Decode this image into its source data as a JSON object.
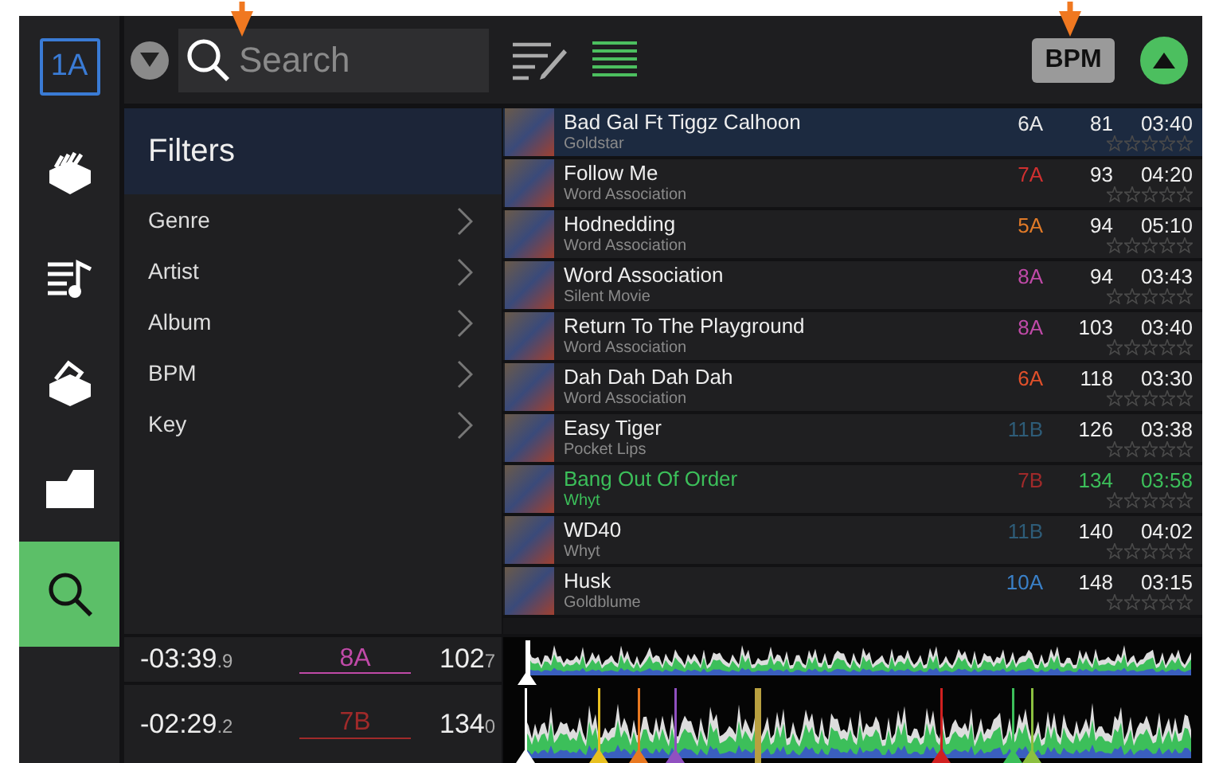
{
  "deck_badge": "1A",
  "sidebar": {
    "items": [
      {
        "kind": "crates",
        "selected": false
      },
      {
        "kind": "playlist",
        "selected": false
      },
      {
        "kind": "prepare",
        "selected": false
      },
      {
        "kind": "folder",
        "selected": false
      },
      {
        "kind": "search",
        "selected": true
      }
    ]
  },
  "toolbar": {
    "search": {
      "placeholder": "Search"
    },
    "view_buttons": [
      {
        "kind": "edit",
        "selected": false
      },
      {
        "kind": "list",
        "selected": true
      }
    ],
    "sort_button": "BPM"
  },
  "filters": {
    "title": "Filters",
    "items": [
      "Genre",
      "Artist",
      "Album",
      "BPM",
      "Key"
    ]
  },
  "tracks": [
    {
      "title": "Bad Gal Ft Tiggz Calhoon",
      "artist": "Goldstar",
      "key": "6A",
      "color": "#e8e8e8",
      "bpm": "81",
      "time": "03:40",
      "stars": 0,
      "selected": true,
      "loaded": false
    },
    {
      "title": "Follow Me",
      "artist": "Word Association",
      "key": "7A",
      "color": "#d03030",
      "bpm": "93",
      "time": "04:20",
      "stars": 0,
      "selected": false,
      "loaded": false
    },
    {
      "title": "Hodnedding",
      "artist": "Word Association",
      "key": "5A",
      "color": "#e07a28",
      "bpm": "94",
      "time": "05:10",
      "stars": 0,
      "selected": false,
      "loaded": false
    },
    {
      "title": "Word Association",
      "artist": "Silent Movie",
      "key": "8A",
      "color": "#c04aa8",
      "bpm": "94",
      "time": "03:43",
      "stars": 0,
      "selected": false,
      "loaded": false
    },
    {
      "title": "Return To The Playground",
      "artist": "Word Association",
      "key": "8A",
      "color": "#c04aa8",
      "bpm": "103",
      "time": "03:40",
      "stars": 0,
      "selected": false,
      "loaded": false
    },
    {
      "title": "Dah Dah Dah Dah",
      "artist": "Word Association",
      "key": "6A",
      "color": "#e0502a",
      "bpm": "118",
      "time": "03:30",
      "stars": 0,
      "selected": false,
      "loaded": false
    },
    {
      "title": "Easy Tiger",
      "artist": "Pocket Lips",
      "key": "11B",
      "color": "#2e5c78",
      "bpm": "126",
      "time": "03:38",
      "stars": 0,
      "selected": false,
      "loaded": false
    },
    {
      "title": "Bang Out Of Order",
      "artist": "Whyt",
      "key": "7B",
      "color": "#a02a2a",
      "bpm": "134",
      "time": "03:58",
      "stars": 0,
      "selected": false,
      "loaded": true
    },
    {
      "title": "WD40",
      "artist": "Whyt",
      "key": "11B",
      "color": "#2e5c78",
      "bpm": "140",
      "time": "04:02",
      "stars": 0,
      "selected": false,
      "loaded": false
    },
    {
      "title": "Husk",
      "artist": "Goldblume",
      "key": "10A",
      "color": "#3a80c8",
      "bpm": "148",
      "time": "03:15",
      "stars": 0,
      "selected": false,
      "loaded": false
    }
  ],
  "decks": [
    {
      "time": "-03:39",
      "time_fraction": ".9",
      "key": "8A",
      "color": "#c04aa8",
      "bpm": "102",
      "bpm_fraction": "7"
    },
    {
      "time": "-02:29",
      "time_fraction": ".2",
      "key": "7B",
      "color": "#a02a2a",
      "bpm": "134",
      "bpm_fraction": "0"
    }
  ]
}
